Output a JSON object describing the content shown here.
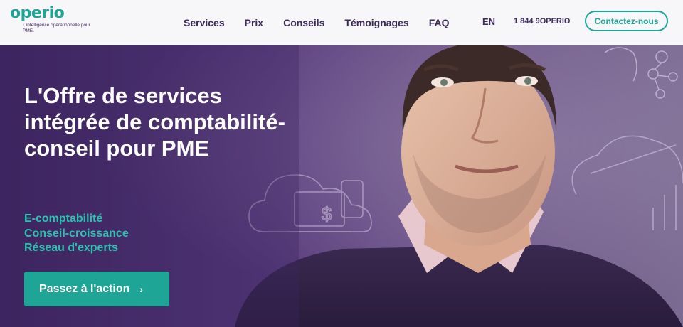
{
  "header": {
    "logo": {
      "word": "operio",
      "tagline": "L'intelligence opérationnelle pour PME."
    },
    "nav": [
      "Services",
      "Prix",
      "Conseils",
      "Témoignages",
      "FAQ"
    ],
    "language": "EN",
    "phone": "1 844 9OPERIO",
    "contact_label": "Contactez-nous"
  },
  "hero": {
    "title": "L'Offre de services intégrée de comptabilité-conseil pour PME",
    "features": [
      "E-comptabilité",
      "Conseil-croissance",
      "Réseau d'experts"
    ],
    "cta_label": "Passez à l'action",
    "cta_icon": "chevron-right-icon"
  },
  "colors": {
    "brand_teal": "#1ea595",
    "brand_purple": "#4a2a6b",
    "hero_bg": "#573a7c",
    "feature_text": "#2bc2ae"
  }
}
